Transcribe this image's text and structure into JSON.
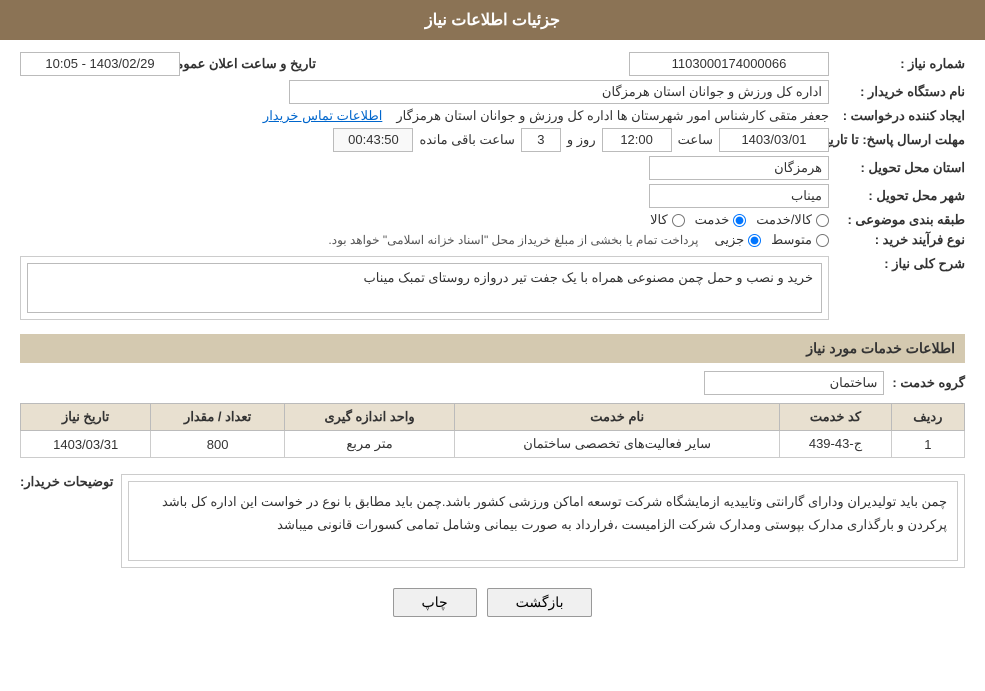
{
  "header": {
    "title": "جزئیات اطلاعات نیاز"
  },
  "fields": {
    "need_number_label": "شماره نیاز :",
    "need_number_value": "1103000174000066",
    "buyer_org_label": "نام دستگاه خریدار :",
    "buyer_org_value": "اداره کل ورزش و جوانان استان هرمزگان",
    "created_by_label": "ایجاد کننده درخواست :",
    "created_by_value": "جعفر متقی کارشناس امور شهرستان ها اداره کل ورزش و جوانان استان هرمزگار",
    "contact_link": "اطلاعات تماس خریدار",
    "publish_datetime_label": "تاریخ و ساعت اعلان عمومی :",
    "publish_datetime_value": "1403/02/29 - 10:05",
    "deadline_label": "مهلت ارسال پاسخ: تا تاریخ:",
    "deadline_date": "1403/03/01",
    "deadline_time_label": "ساعت",
    "deadline_time": "12:00",
    "deadline_days_label": "روز و",
    "deadline_days": "3",
    "remaining_label": "ساعت باقی مانده",
    "remaining_time": "00:43:50",
    "province_label": "استان محل تحویل :",
    "province_value": "هرمزگان",
    "city_label": "شهر محل تحویل :",
    "city_value": "میناب",
    "category_label": "طبقه بندی موضوعی :",
    "category_options": [
      {
        "label": "کالا",
        "value": "kala"
      },
      {
        "label": "خدمت",
        "value": "khedmat"
      },
      {
        "label": "کالا/خدمت",
        "value": "kala_khedmat"
      }
    ],
    "category_selected": "khedmat",
    "purchase_type_label": "نوع فرآیند خرید :",
    "purchase_type_options": [
      {
        "label": "جزیی",
        "value": "jozi"
      },
      {
        "label": "متوسط",
        "value": "motavasset"
      }
    ],
    "purchase_type_selected": "jozi",
    "purchase_type_note": "پرداخت تمام یا بخشی از مبلغ خریداز محل \"اسناد خزانه اسلامی\" خواهد بود.",
    "need_description_label": "شرح کلی نیاز :",
    "need_description_value": "خرید و نصب  و حمل چمن مصنوعی همراه با یک جفت تیر دروازه روستای تمبک میناب",
    "services_section_label": "اطلاعات خدمات مورد نیاز",
    "service_group_label": "گروه خدمت :",
    "service_group_value": "ساختمان",
    "table": {
      "headers": [
        "ردیف",
        "کد خدمت",
        "نام خدمت",
        "واحد اندازه گیری",
        "تعداد / مقدار",
        "تاریخ نیاز"
      ],
      "rows": [
        {
          "row": "1",
          "code": "ج-43-439",
          "name": "سایر فعالیت‌های تخصصی ساختمان",
          "unit": "متر مربع",
          "quantity": "800",
          "date": "1403/03/31"
        }
      ]
    },
    "buyer_notes_label": "توضیحات خریدار:",
    "buyer_notes_value": "چمن باید تولیدیران ودارای گارانتی وتاییدیه ازمایشگاه شرکت توسعه اماکن ورزشی کشور باشد.چمن باید مطابق با نوع در خواست این اداره کل باشد پرکردن و بارگذاری مدارک بپوستی  ومدارک شرکت الزامیست ،فرارداد به صورت بیمانی وشامل تمامی کسورات قانونی میباشد"
  },
  "buttons": {
    "back_label": "بازگشت",
    "print_label": "چاپ"
  }
}
